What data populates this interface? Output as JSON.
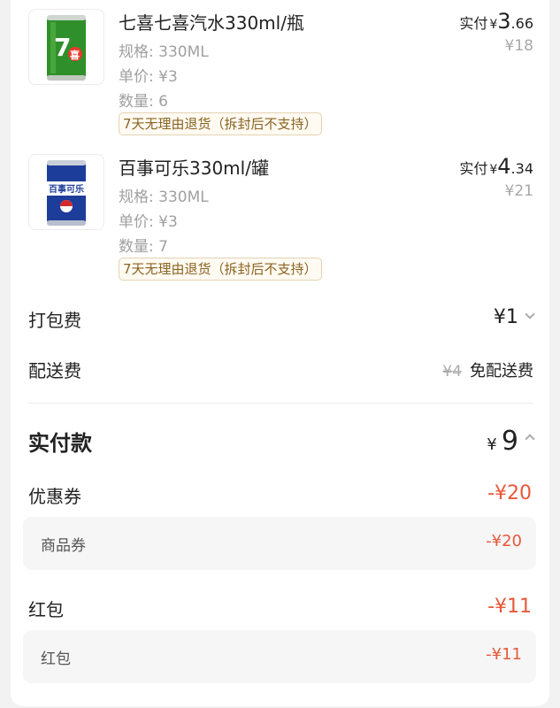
{
  "products": [
    {
      "name": "七喜七喜汽水330ml/瓶",
      "spec_label": "规格: ",
      "spec": "330ML",
      "unit_label": "单价: ",
      "unit_price": "¥3",
      "qty_label": "数量: ",
      "qty": "6",
      "tag": "7天无理由退货（拆封后不支持）",
      "paid_label": "实付",
      "paid_currency": "¥",
      "paid_int": "3",
      "paid_dec": ".66",
      "original": "¥18"
    },
    {
      "name": "百事可乐330ml/罐",
      "spec_label": "规格: ",
      "spec": "330ML",
      "unit_label": "单价: ",
      "unit_price": "¥3",
      "qty_label": "数量: ",
      "qty": "7",
      "tag": "7天无理由退货（拆封后不支持）",
      "paid_label": "实付",
      "paid_currency": "¥",
      "paid_int": "4",
      "paid_dec": ".34",
      "original": "¥21"
    }
  ],
  "fees": {
    "packing_label": "打包费",
    "packing_value": "¥1",
    "delivery_label": "配送费",
    "delivery_strike": "¥4",
    "delivery_free": "免配送费"
  },
  "total": {
    "label": "实付款",
    "currency": "¥",
    "value": "9"
  },
  "coupon": {
    "label": "优惠券",
    "value": "-¥20",
    "sub_label": "商品券",
    "sub_value": "-¥20"
  },
  "redpacket": {
    "label": "红包",
    "value": "-¥11",
    "sub_label": "红包",
    "sub_value": "-¥11"
  },
  "icons": {
    "can1": "7up-can-icon",
    "can2": "pepsi-can-icon",
    "expand": "chevron-down-icon",
    "collapse": "chevron-up-icon"
  },
  "colors": {
    "accent_red": "#e8583a",
    "tag_text": "#8a6320",
    "tag_border": "#e3d3b3"
  }
}
